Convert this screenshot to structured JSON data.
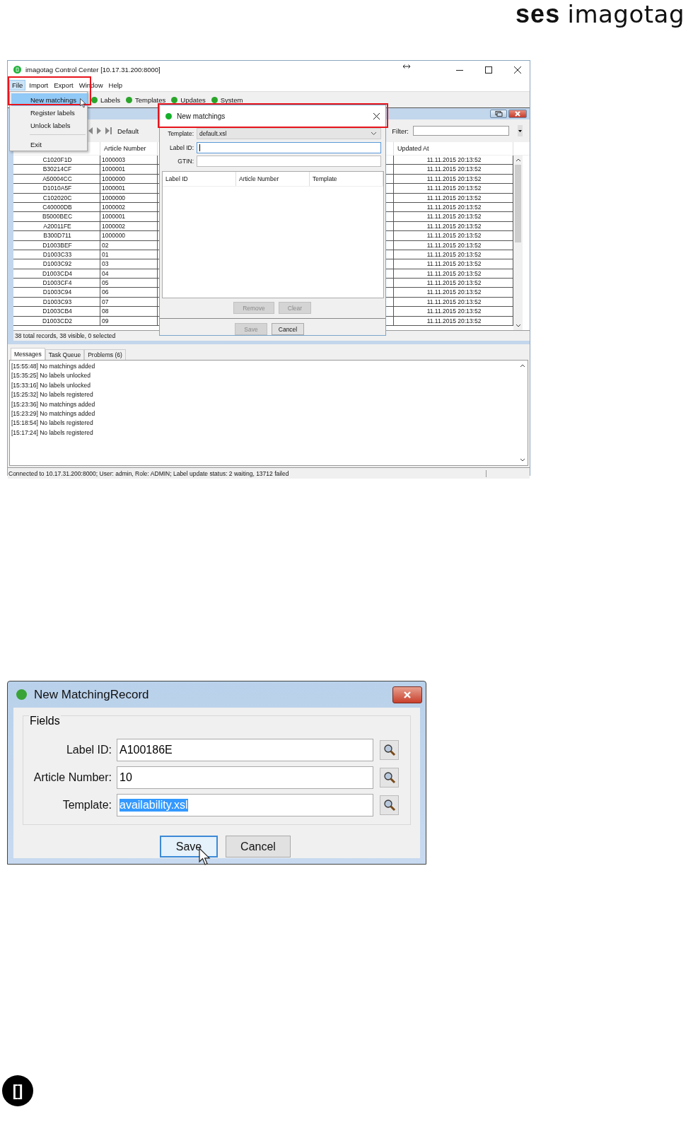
{
  "logo": {
    "bold": "ses",
    "light": "imagotag"
  },
  "app_window": {
    "title": "imagotag Control Center [10.17.31.200:8000]",
    "menu": [
      {
        "label": "File",
        "selected": true
      },
      {
        "label": "Import",
        "selected": false
      },
      {
        "label": "Export",
        "selected": false
      },
      {
        "label": "Window",
        "selected": false
      },
      {
        "label": "Help",
        "selected": false
      }
    ],
    "file_menu": [
      {
        "kind": "item",
        "label": "New matchings",
        "selected": true
      },
      {
        "kind": "item",
        "label": "Register labels",
        "selected": false
      },
      {
        "kind": "item",
        "label": "Unlock labels",
        "selected": false
      },
      {
        "kind": "separator"
      },
      {
        "kind": "item",
        "label": "Exit",
        "selected": false
      }
    ],
    "toolbar": [
      "Labels",
      "Templates",
      "Updates",
      "System"
    ],
    "records": {
      "view": "Default",
      "filter_label": "Filter:",
      "columns": [
        "Article Number",
        "Updated At"
      ],
      "rows": [
        {
          "label_id": "C1020F1D",
          "article_number": "1000003",
          "updated_at": "11.11.2015 20:13:52"
        },
        {
          "label_id": "B30214CF",
          "article_number": "1000001",
          "updated_at": "11.11.2015 20:13:52"
        },
        {
          "label_id": "A50004CC",
          "article_number": "1000000",
          "updated_at": "11.11.2015 20:13:52"
        },
        {
          "label_id": "D1010A5F",
          "article_number": "1000001",
          "updated_at": "11.11.2015 20:13:52"
        },
        {
          "label_id": "C102020C",
          "article_number": "1000000",
          "updated_at": "11.11.2015 20:13:52"
        },
        {
          "label_id": "C40000DB",
          "article_number": "1000002",
          "updated_at": "11.11.2015 20:13:52"
        },
        {
          "label_id": "B5000BEC",
          "article_number": "1000001",
          "updated_at": "11.11.2015 20:13:52"
        },
        {
          "label_id": "A20011FE",
          "article_number": "1000002",
          "updated_at": "11.11.2015 20:13:52"
        },
        {
          "label_id": "B300D711",
          "article_number": "1000000",
          "updated_at": "11.11.2015 20:13:52"
        },
        {
          "label_id": "D1003BEF",
          "article_number": "02",
          "updated_at": "11.11.2015 20:13:52"
        },
        {
          "label_id": "D1003C33",
          "article_number": "01",
          "updated_at": "11.11.2015 20:13:52"
        },
        {
          "label_id": "D1003C92",
          "article_number": "03",
          "updated_at": "11.11.2015 20:13:52"
        },
        {
          "label_id": "D1003CD4",
          "article_number": "04",
          "updated_at": "11.11.2015 20:13:52"
        },
        {
          "label_id": "D1003CF4",
          "article_number": "05",
          "updated_at": "11.11.2015 20:13:52"
        },
        {
          "label_id": "D1003C94",
          "article_number": "06",
          "updated_at": "11.11.2015 20:13:52"
        },
        {
          "label_id": "D1003C93",
          "article_number": "07",
          "updated_at": "11.11.2015 20:13:52"
        },
        {
          "label_id": "D1003CB4",
          "article_number": "08",
          "updated_at": "11.11.2015 20:13:52"
        },
        {
          "label_id": "D1003CD2",
          "article_number": "09",
          "updated_at": "11.11.2015 20:13:52"
        }
      ],
      "status": "38 total records, 38 visible, 0 selected"
    },
    "dialog": {
      "title": "New matchings",
      "template_label": "Template:",
      "template_value": "default.xsl",
      "fields": [
        {
          "label": "Label ID:",
          "focused": true
        },
        {
          "label": "GTIN:",
          "focused": false
        }
      ],
      "columns": [
        "Label ID",
        "Article Number",
        "Template"
      ],
      "list_buttons": [
        {
          "label": "Remove",
          "disabled": true
        },
        {
          "label": "Clear",
          "disabled": true
        }
      ],
      "footer_buttons": [
        {
          "label": "Save",
          "disabled": true
        },
        {
          "label": "Cancel",
          "disabled": false
        }
      ]
    },
    "message_tabs": [
      {
        "label": "Messages",
        "selected": true
      },
      {
        "label": "Task Queue",
        "selected": false
      },
      {
        "label": "Problems (6)",
        "selected": false
      }
    ],
    "messages": [
      "[15:55:48] No matchings added",
      "[15:35:25] No labels unlocked",
      "[15:33:16] No labels unlocked",
      "[15:25:32] No labels registered",
      "[15:23:36] No matchings added",
      "[15:23:29] No matchings added",
      "[15:18:54] No labels registered",
      "[15:17:24] No labels registered"
    ],
    "status_bar": "Connected to 10.17.31.200:8000; User: admin, Role: ADMIN; Label update status: 2 waiting, 13712 failed"
  },
  "record_dialog": {
    "title": "New MatchingRecord",
    "group": "Fields",
    "fields": [
      {
        "label": "Label ID:",
        "value": "A100186E",
        "selected": false
      },
      {
        "label": "Article Number:",
        "value": "10",
        "selected": false
      },
      {
        "label": "Template:",
        "value": "availability.xsl",
        "selected": true
      }
    ],
    "buttons": [
      {
        "label": "Save",
        "focused": true
      },
      {
        "label": "Cancel",
        "focused": false
      }
    ]
  },
  "badge": "[]"
}
